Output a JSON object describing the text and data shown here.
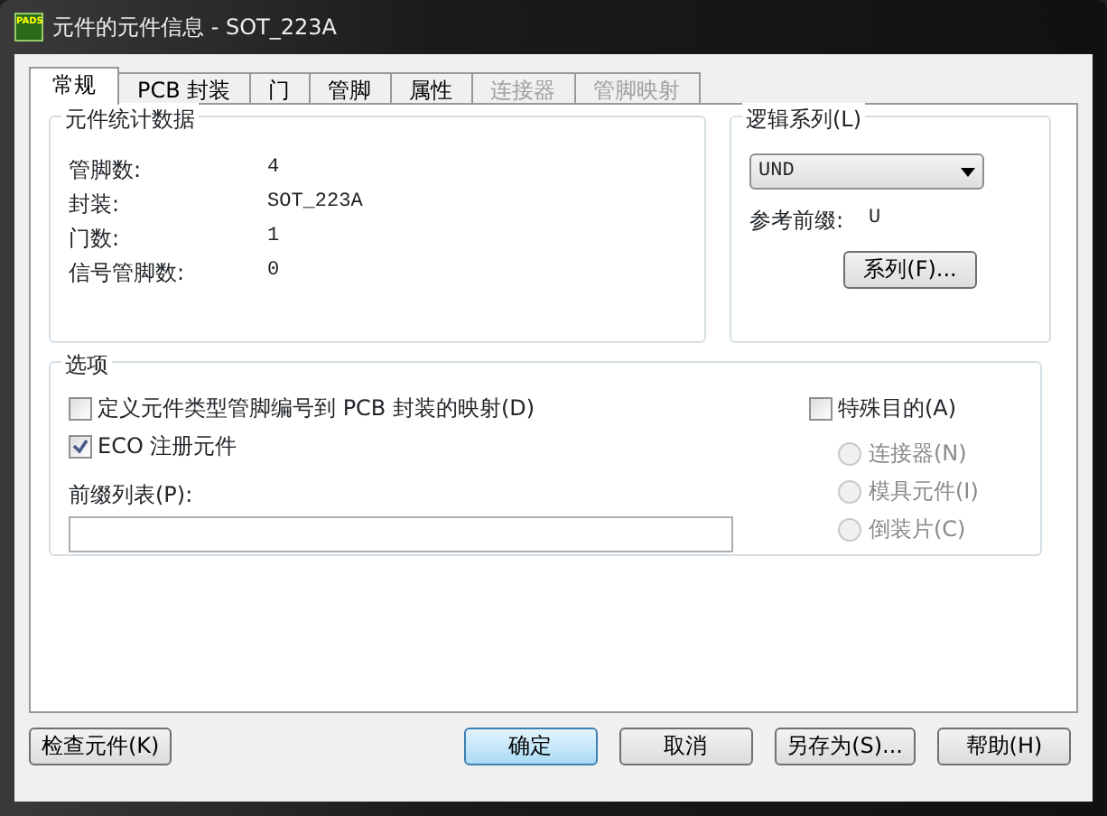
{
  "window": {
    "title": "元件的元件信息 - SOT_223A",
    "icon_text": "PADS"
  },
  "tabs": [
    {
      "label": "常规",
      "selected": true,
      "disabled": false
    },
    {
      "label": "PCB 封装",
      "selected": false,
      "disabled": false
    },
    {
      "label": "门",
      "selected": false,
      "disabled": false
    },
    {
      "label": "管脚",
      "selected": false,
      "disabled": false
    },
    {
      "label": "属性",
      "selected": false,
      "disabled": false
    },
    {
      "label": "连接器",
      "selected": false,
      "disabled": true
    },
    {
      "label": "管脚映射",
      "selected": false,
      "disabled": true
    }
  ],
  "statistics": {
    "title": "元件统计数据",
    "rows": [
      {
        "label": "管脚数:",
        "value": "4"
      },
      {
        "label": "封装:",
        "value": "SOT_223A"
      },
      {
        "label": "门数:",
        "value": "1"
      },
      {
        "label": "信号管脚数:",
        "value": "0"
      }
    ]
  },
  "logic_family": {
    "title": "逻辑系列(L)",
    "value": "UND",
    "prefix_label": "参考前缀:",
    "prefix_value": "U",
    "button": "系列(F)..."
  },
  "options": {
    "title": "选项",
    "checkboxes": [
      {
        "label": "定义元件类型管脚编号到 PCB 封装的映射(D)",
        "checked": false
      },
      {
        "label": "ECO 注册元件",
        "checked": true
      }
    ],
    "prefix_list": {
      "label": "前缀列表(P):"
    },
    "special": {
      "label": "特殊目的(A)",
      "checked": false
    },
    "radios": [
      {
        "label": "连接器(N)",
        "selected": false,
        "disabled": true
      },
      {
        "label": "模具元件(I)",
        "selected": false,
        "disabled": true
      },
      {
        "label": "倒装片(C)",
        "selected": false,
        "disabled": true
      }
    ]
  },
  "buttons": [
    {
      "label": "检查元件(K)",
      "kind": "left",
      "default": false
    },
    {
      "label": "确定",
      "kind": "right",
      "default": true
    },
    {
      "label": "取消",
      "kind": "right",
      "default": false
    },
    {
      "label": "另存为(S)...",
      "kind": "right",
      "default": false
    },
    {
      "label": "帮助(H)",
      "kind": "right",
      "default": false
    }
  ]
}
